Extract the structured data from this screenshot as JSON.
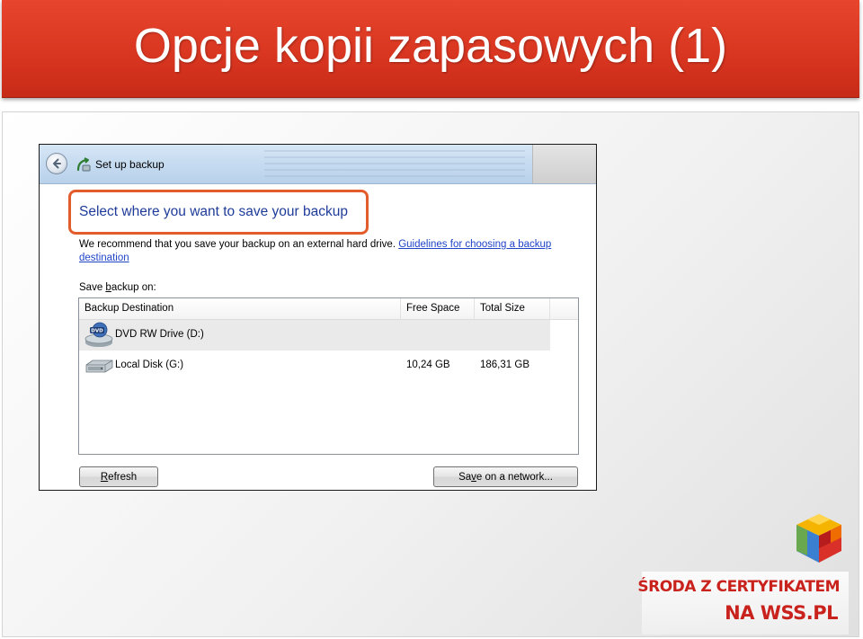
{
  "slide": {
    "title": "Opcje kopii zapasowych (1)"
  },
  "dialog": {
    "title": "Set up backup",
    "heading": "Select where you want to save your backup",
    "recommend_text": "We recommend that you save your backup on an external hard drive.",
    "guidelines_link": "Guidelines for choosing a backup destination",
    "save_on_label_prefix": "Save ",
    "save_on_label_accel": "b",
    "save_on_label_suffix": "ackup on:",
    "columns": {
      "destination": "Backup Destination",
      "free_space": "Free Space",
      "total_size": "Total Size"
    },
    "rows": [
      {
        "name": "DVD RW Drive (D:)",
        "free": "",
        "total": "",
        "icon": "dvd-drive-icon"
      },
      {
        "name": "Local Disk (G:)",
        "free": "10,24 GB",
        "total": "186,31 GB",
        "icon": "hard-disk-icon"
      }
    ],
    "refresh_accel": "R",
    "refresh_rest": "efresh",
    "network_prefix": "Sa",
    "network_accel": "v",
    "network_suffix": "e on a network..."
  },
  "logo": {
    "line1": "Środa z certyfikatem",
    "line2": "na WSS.pl"
  },
  "colors": {
    "title_bar": "#d83520",
    "heading_text": "#1e3b9a",
    "highlight_box": "#e35d2c",
    "link": "#1f44c8",
    "logo_text": "#c9221c"
  }
}
